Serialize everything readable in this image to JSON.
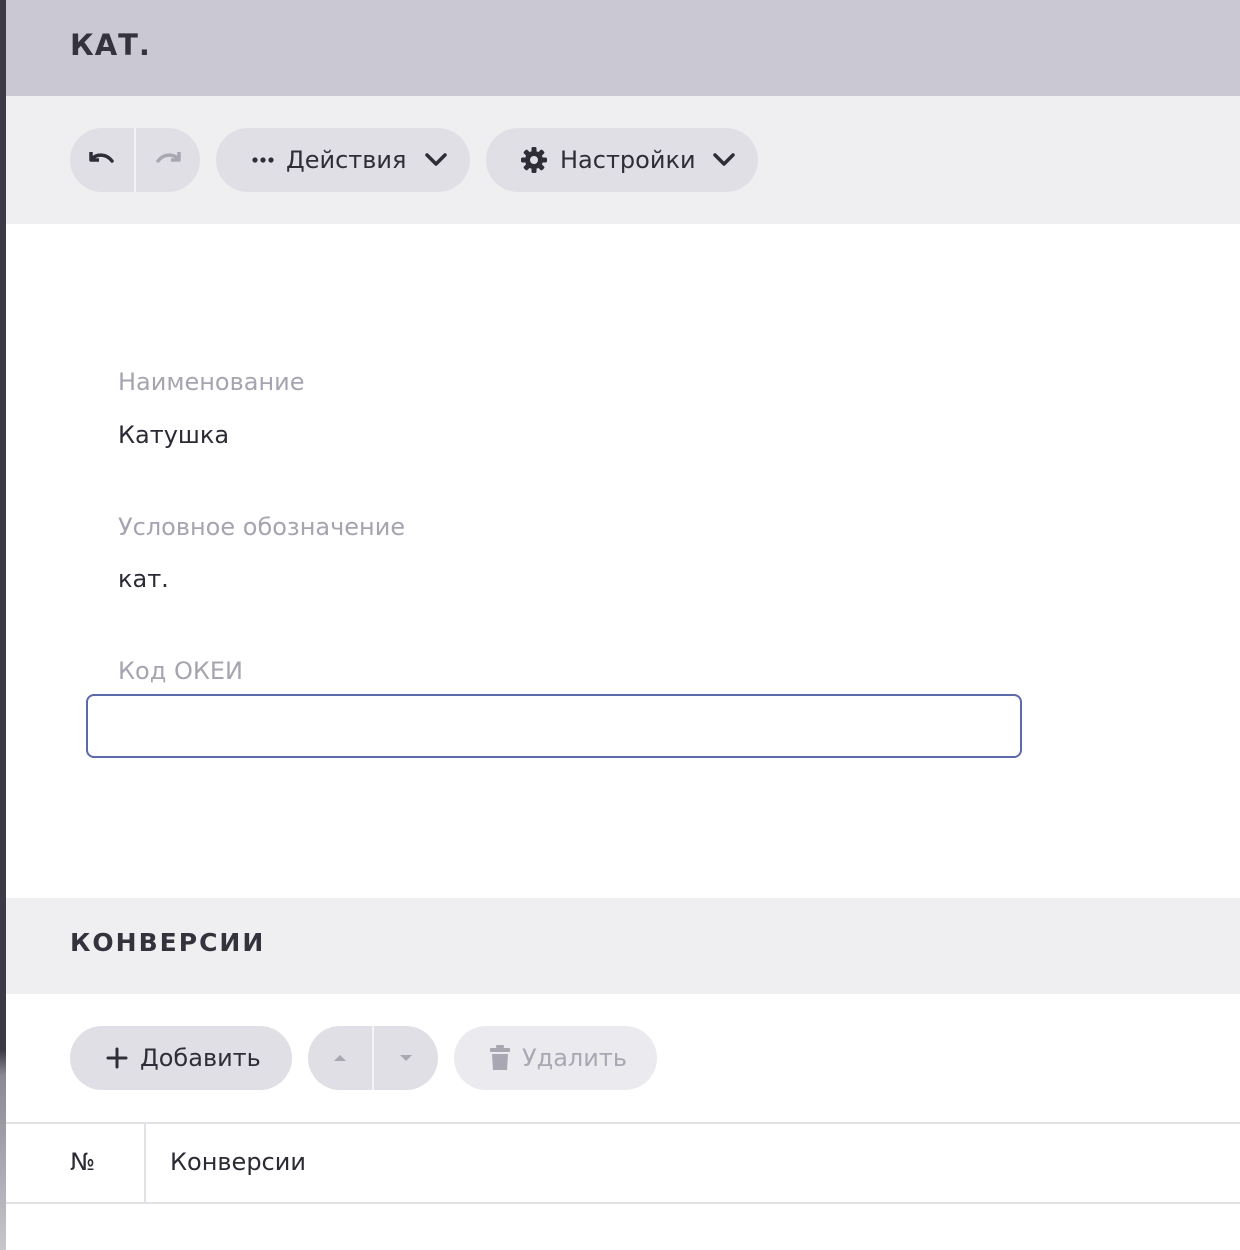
{
  "header": {
    "title": "КАТ."
  },
  "toolbar": {
    "undo_icon": "undo-icon",
    "redo_icon": "redo-icon",
    "actions_label": "Действия",
    "settings_label": "Настройки"
  },
  "form": {
    "name_label": "Наименование",
    "name_value": "Катушка",
    "symbol_label": "Условное обозначение",
    "symbol_value": "кат.",
    "okei_label": "Код ОКЕИ",
    "okei_value": "",
    "okei_focus_color": "#5b6aa8"
  },
  "conversions": {
    "section_title": "КОНВЕРСИИ",
    "add_label": "Добавить",
    "delete_label": "Удалить",
    "columns": [
      "№",
      "Конверсии"
    ],
    "rows": []
  },
  "colors": {
    "header_bg": "#cac8d2",
    "toolbar_bg": "#efeff2",
    "pill_bg": "#e0dfe5",
    "muted_text": "#a6a4b0"
  }
}
